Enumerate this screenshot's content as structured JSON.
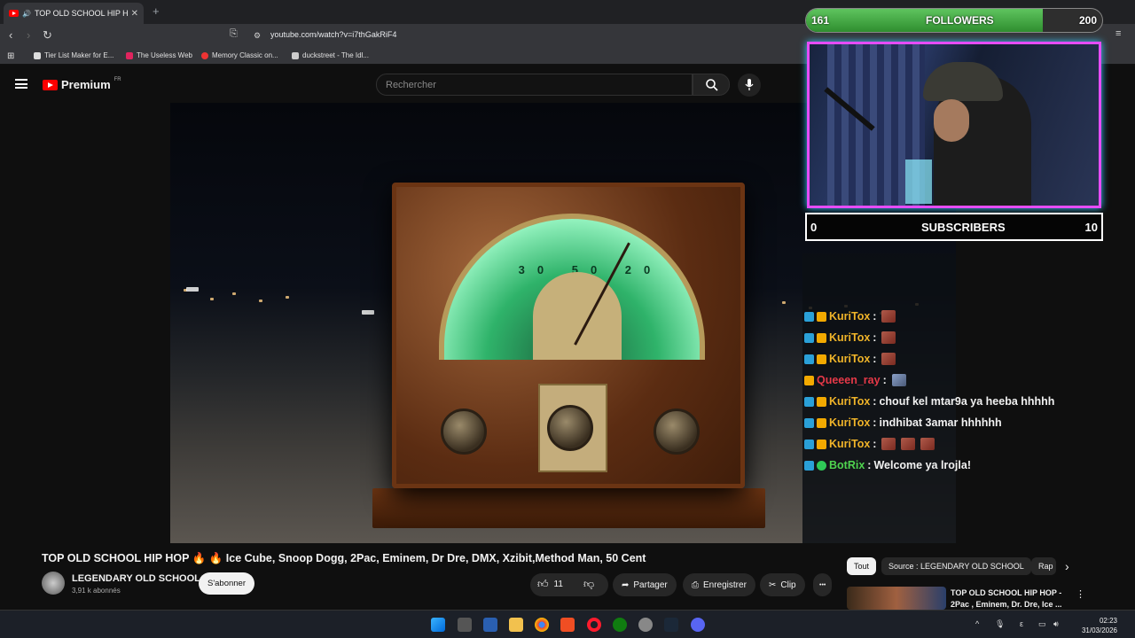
{
  "browser": {
    "tab_title": "TOP OLD SCHOOL HIP HOP 🔥",
    "new_tab": "+",
    "close": "✕",
    "url": "youtube.com/watch?v=i7thGakRiF4",
    "bookmarks": [
      "Tier List Maker for E...",
      "The Useless Web",
      "Memory Classic on...",
      "duckstreet - The Idl..."
    ]
  },
  "youtube": {
    "logo": "Premium",
    "logo_region": "FR",
    "search_placeholder": "Rechercher"
  },
  "overlay": {
    "followers_label": "FOLLOWERS",
    "followers_current": "161",
    "followers_goal": "200",
    "followers_progress": 0.8,
    "subscribers_label": "SUBSCRIBERS",
    "subscribers_current": "0",
    "subscribers_goal": "10"
  },
  "chat": [
    {
      "user": "KuriTox",
      "text": "",
      "emotes": 1,
      "style": "gold"
    },
    {
      "user": "KuriTox",
      "text": "",
      "emotes": 1,
      "style": "gold"
    },
    {
      "user": "KuriTox",
      "text": "",
      "emotes": 1,
      "style": "gold"
    },
    {
      "user": "Queeen_ray",
      "text": "",
      "emotes": 1,
      "style": "red"
    },
    {
      "user": "KuriTox",
      "text": "chouf kel mtar9a ya heeba hhhhh",
      "emotes": 0,
      "style": "gold"
    },
    {
      "user": "KuriTox",
      "text": "indhibat 3amar hhhhhh",
      "emotes": 0,
      "style": "gold"
    },
    {
      "user": "KuriTox",
      "text": "",
      "emotes": 3,
      "style": "gold"
    },
    {
      "user": "BotRix",
      "text": "Welcome ya lrojla!",
      "emotes": 0,
      "style": "green"
    }
  ],
  "video": {
    "title": "TOP OLD SCHOOL HIP HOP 🔥 🔥 Ice Cube, Snoop Dogg, 2Pac, Eminem, Dr Dre, DMX, Xzibit,Method Man, 50 Cent",
    "channel": "LEGENDARY OLD SCHOOL",
    "channel_subs": "3,91 k abonnés",
    "subscribe": "S'abonner",
    "likes": "11",
    "share": "Partager",
    "save": "Enregistrer",
    "clip": "Clip",
    "more": "•••"
  },
  "sidebar": {
    "chips": [
      "Tout",
      "Source : LEGENDARY OLD SCHOOL",
      "Rap"
    ],
    "reco_title": "TOP OLD SCHOOL HIP HOP - 2Pac , Eminem, Dr. Dre, Ice ..."
  },
  "taskbar": {
    "time": "02:23",
    "date": "31/03/2026"
  }
}
